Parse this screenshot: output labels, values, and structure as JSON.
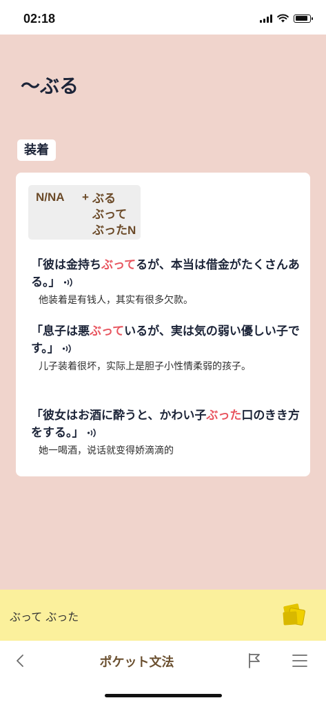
{
  "status": {
    "time": "02:18"
  },
  "page": {
    "title": "〜ぶる",
    "section_label": "装着"
  },
  "formula": {
    "left": "N/NA",
    "plus": "+",
    "forms": [
      "ぶる",
      "ぶって",
      "ぶったN"
    ]
  },
  "examples": [
    {
      "before": "「彼は金持ち",
      "highlight": "ぶって",
      "after": "るが、本当は借金がたくさんある。」",
      "translation": "他装着是有钱人，其实有很多欠款。"
    },
    {
      "before": "「息子は悪",
      "highlight": "ぶって",
      "after": "いるが、実は気の弱い優しい子です。」",
      "translation": "儿子装着很坏，实际上是胆子小性情柔弱的孩子。"
    },
    {
      "before": "「彼女はお酒に酔うと、かわい子",
      "highlight": "ぶった",
      "after": "口のきき方をする。」",
      "translation": "她一喝酒，说话就变得娇滴滴的"
    }
  ],
  "banner": {
    "text": "ぶって ぶった"
  },
  "tabbar": {
    "title": "ポケット文法"
  },
  "colors": {
    "background": "#f0d4cc",
    "highlight": "#e8555f",
    "banner": "#fbf09c"
  }
}
